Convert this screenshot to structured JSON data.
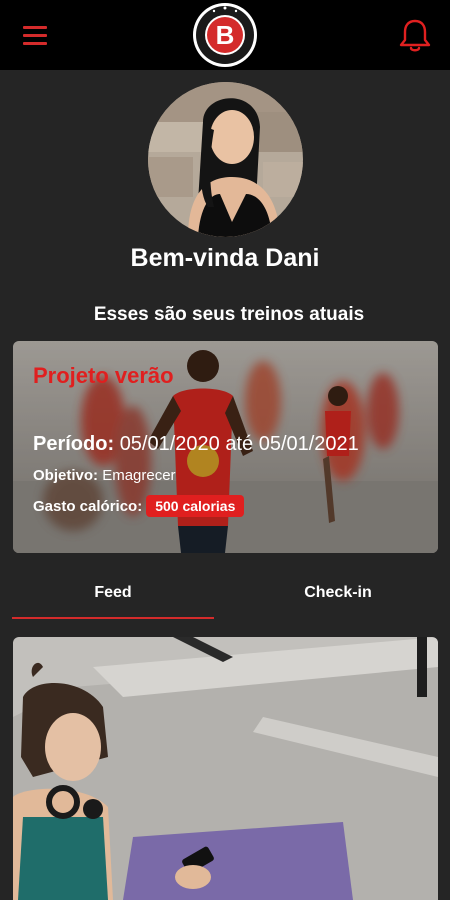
{
  "header": {
    "menu_icon": "hamburger-menu-icon",
    "logo_icon": "brand-logo",
    "logo_letter": "B",
    "bell_icon": "bell-icon",
    "accent_color": "#d42b2b"
  },
  "profile": {
    "welcome": "Bem-vinda Dani",
    "subtitle": "Esses são seus treinos atuais"
  },
  "workout": {
    "title": "Projeto verão",
    "period_label": "Período:",
    "period_value": "05/01/2020 até 05/01/2021",
    "goal_label": "Objetivo:",
    "goal_value": "Emagrecer",
    "calories_label": "Gasto calórico:",
    "calories_value": "500 calorias"
  },
  "tabs": [
    {
      "label": "Feed",
      "active": true
    },
    {
      "label": "Check-in",
      "active": false
    }
  ]
}
